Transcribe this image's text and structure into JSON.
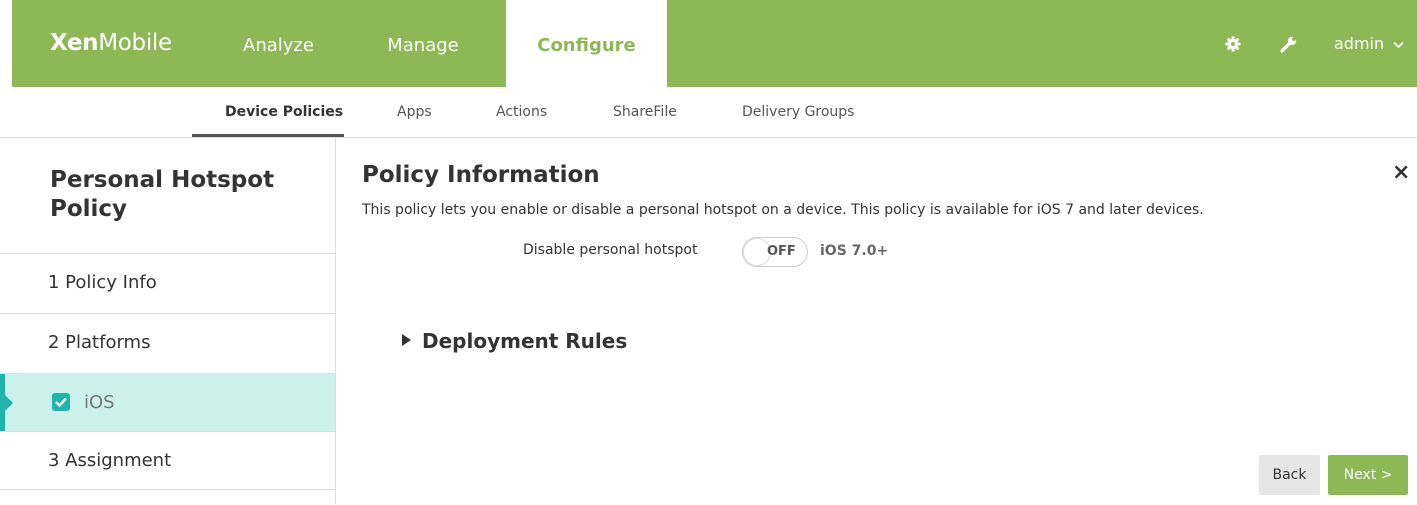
{
  "header": {
    "logo_bold": "Xen",
    "logo_rest": "Mobile",
    "tabs": [
      {
        "label": "Analyze"
      },
      {
        "label": "Manage"
      },
      {
        "label": "Configure"
      }
    ],
    "user": "admin"
  },
  "subnav": {
    "items": [
      {
        "label": "Device Policies"
      },
      {
        "label": "Apps"
      },
      {
        "label": "Actions"
      },
      {
        "label": "ShareFile"
      },
      {
        "label": "Delivery Groups"
      }
    ]
  },
  "sidebar": {
    "title": "Personal Hotspot Policy",
    "items": [
      {
        "label": "1  Policy Info"
      },
      {
        "label": "2  Platforms"
      },
      {
        "label": "iOS"
      },
      {
        "label": "3  Assignment"
      }
    ]
  },
  "main": {
    "title": "Policy Information",
    "description": "This policy lets you enable or disable a personal hotspot on a device. This policy is available for iOS 7 and later devices.",
    "field_label": "Disable personal hotspot",
    "toggle_text": "OFF",
    "ios_version": "iOS 7.0+",
    "deployment_rules": "Deployment Rules",
    "close": "×"
  },
  "buttons": {
    "back": "Back",
    "next": "Next >"
  },
  "colors": {
    "brand_green": "#8db856",
    "teal": "#1fb5ad",
    "selected_bg": "#cdf2ee"
  }
}
